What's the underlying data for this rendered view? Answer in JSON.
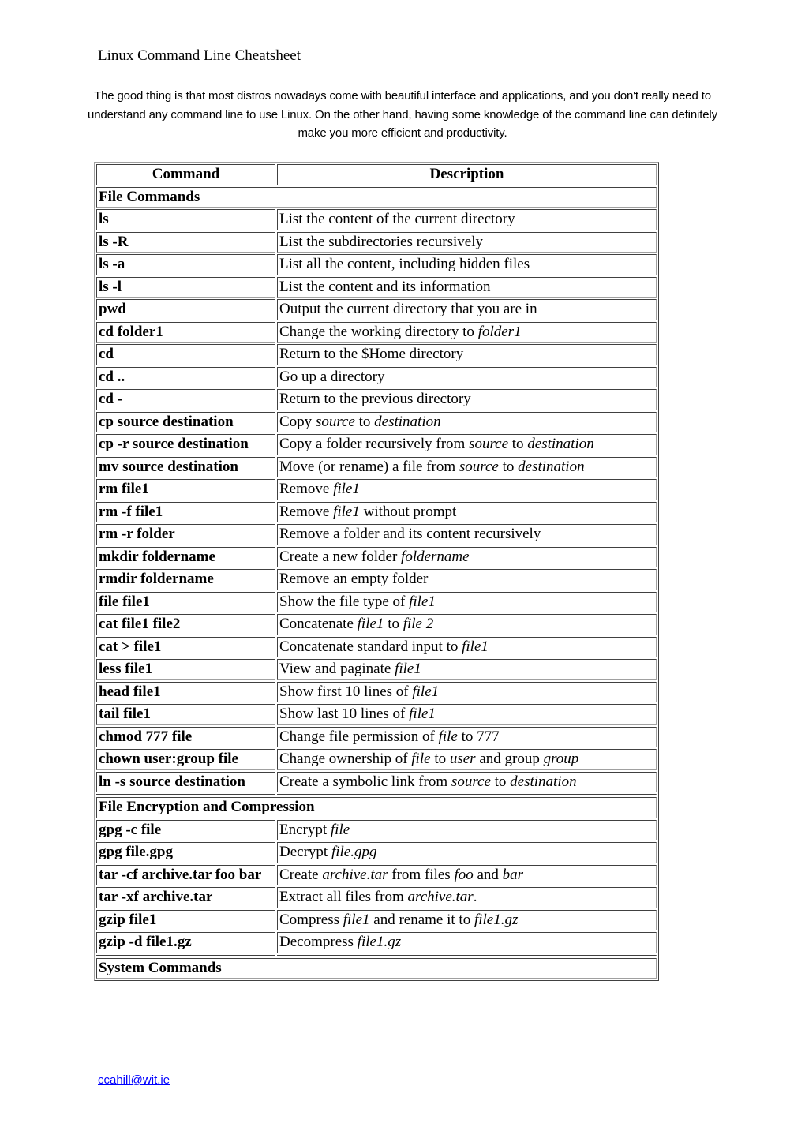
{
  "title": "Linux Command Line Cheatsheet",
  "intro": "The good thing is that most distros nowadays come with beautiful interface and applications, and you don't really need to understand any command line to use Linux. On the other hand, having some knowledge of the command line can definitely make you more efficient and productivity.",
  "table": {
    "headers": {
      "command": "Command",
      "description": "Description"
    },
    "sections": [
      {
        "title": "File Commands",
        "rows": [
          {
            "command": "ls",
            "description": [
              {
                "t": "List the content of the current directory"
              }
            ]
          },
          {
            "command": "ls -R",
            "description": [
              {
                "t": "List the subdirectories recursively"
              }
            ]
          },
          {
            "command": "ls -a",
            "description": [
              {
                "t": "List all the content, including hidden files"
              }
            ]
          },
          {
            "command": "ls -l",
            "description": [
              {
                "t": "List the content and its information"
              }
            ]
          },
          {
            "command": "pwd",
            "description": [
              {
                "t": "Output the current directory that you are in"
              }
            ]
          },
          {
            "command": "cd folder1",
            "description": [
              {
                "t": "Change the working directory to "
              },
              {
                "t": "folder1",
                "i": true
              }
            ]
          },
          {
            "command": "cd",
            "description": [
              {
                "t": "Return to the $Home directory"
              }
            ]
          },
          {
            "command": "cd ..",
            "description": [
              {
                "t": "Go up a directory"
              }
            ]
          },
          {
            "command": "cd -",
            "description": [
              {
                "t": "Return to the previous directory"
              }
            ]
          },
          {
            "command": "cp source destination",
            "description": [
              {
                "t": "Copy "
              },
              {
                "t": "source",
                "i": true
              },
              {
                "t": " to "
              },
              {
                "t": "destination",
                "i": true
              }
            ]
          },
          {
            "command": "cp -r source destination",
            "description": [
              {
                "t": "Copy a folder recursively from "
              },
              {
                "t": "source",
                "i": true
              },
              {
                "t": " to "
              },
              {
                "t": "destination",
                "i": true
              }
            ]
          },
          {
            "command": "mv source destination",
            "description": [
              {
                "t": "Move (or rename) a file from "
              },
              {
                "t": "source",
                "i": true
              },
              {
                "t": " to "
              },
              {
                "t": "destination",
                "i": true
              }
            ]
          },
          {
            "command": "rm file1",
            "description": [
              {
                "t": "Remove "
              },
              {
                "t": "file1",
                "i": true
              }
            ]
          },
          {
            "command": "rm -f file1",
            "description": [
              {
                "t": "Remove "
              },
              {
                "t": "file1",
                "i": true
              },
              {
                "t": " without prompt"
              }
            ]
          },
          {
            "command": "rm -r folder",
            "description": [
              {
                "t": "Remove a folder and its content recursively"
              }
            ]
          },
          {
            "command": "mkdir foldername",
            "description": [
              {
                "t": "Create a new folder "
              },
              {
                "t": "foldername",
                "i": true
              }
            ]
          },
          {
            "command": "rmdir foldername",
            "description": [
              {
                "t": "Remove an empty folder"
              }
            ]
          },
          {
            "command": "file file1",
            "description": [
              {
                "t": "Show the file type of "
              },
              {
                "t": "file1",
                "i": true
              }
            ]
          },
          {
            "command": "cat file1 file2",
            "description": [
              {
                "t": "Concatenate "
              },
              {
                "t": "file1",
                "i": true
              },
              {
                "t": " to "
              },
              {
                "t": "file 2",
                "i": true
              }
            ]
          },
          {
            "command": "cat > file1",
            "description": [
              {
                "t": "Concatenate standard input to "
              },
              {
                "t": "file1",
                "i": true
              }
            ]
          },
          {
            "command": "less file1",
            "description": [
              {
                "t": "View and paginate "
              },
              {
                "t": "file1",
                "i": true
              }
            ]
          },
          {
            "command": "head file1",
            "description": [
              {
                "t": "Show first 10 lines of "
              },
              {
                "t": "file1",
                "i": true
              }
            ]
          },
          {
            "command": "tail file1",
            "description": [
              {
                "t": "Show last 10 lines of "
              },
              {
                "t": "file1",
                "i": true
              }
            ]
          },
          {
            "command": "chmod 777 file",
            "description": [
              {
                "t": "Change file permission of "
              },
              {
                "t": "file",
                "i": true
              },
              {
                "t": " to 777"
              }
            ]
          },
          {
            "command": "chown user:group file",
            "description": [
              {
                "t": "Change ownership of "
              },
              {
                "t": "file",
                "i": true
              },
              {
                "t": " to "
              },
              {
                "t": "user",
                "i": true
              },
              {
                "t": " and group "
              },
              {
                "t": "group",
                "i": true
              }
            ]
          },
          {
            "command": "ln -s source destination",
            "description": [
              {
                "t": "Create a symbolic link from "
              },
              {
                "t": "source",
                "i": true
              },
              {
                "t": " to "
              },
              {
                "t": "destination",
                "i": true
              }
            ]
          }
        ]
      },
      {
        "title": "File Encryption and Compression",
        "rows": [
          {
            "command": "gpg -c file",
            "description": [
              {
                "t": "Encrypt "
              },
              {
                "t": "file",
                "i": true
              }
            ]
          },
          {
            "command": "gpg file.gpg",
            "description": [
              {
                "t": "Decrypt "
              },
              {
                "t": "file.gpg",
                "i": true
              }
            ]
          },
          {
            "command": "tar -cf archive.tar foo bar",
            "description": [
              {
                "t": "Create "
              },
              {
                "t": "archive.tar",
                "i": true
              },
              {
                "t": " from files "
              },
              {
                "t": "foo",
                "i": true
              },
              {
                "t": " and "
              },
              {
                "t": "bar",
                "i": true
              }
            ]
          },
          {
            "command": "tar -xf archive.tar",
            "description": [
              {
                "t": "Extract all files from "
              },
              {
                "t": "archive.tar",
                "i": true
              },
              {
                "t": "."
              }
            ]
          },
          {
            "command": "gzip file1",
            "description": [
              {
                "t": "Compress "
              },
              {
                "t": "file1",
                "i": true
              },
              {
                "t": " and rename it to "
              },
              {
                "t": "file1.gz",
                "i": true
              }
            ]
          },
          {
            "command": "gzip -d file1.gz",
            "description": [
              {
                "t": "Decompress "
              },
              {
                "t": "file1.gz",
                "i": true
              }
            ]
          }
        ]
      },
      {
        "title": "System Commands",
        "rows": []
      }
    ]
  },
  "footer": {
    "email": "ccahill@wit.ie"
  }
}
